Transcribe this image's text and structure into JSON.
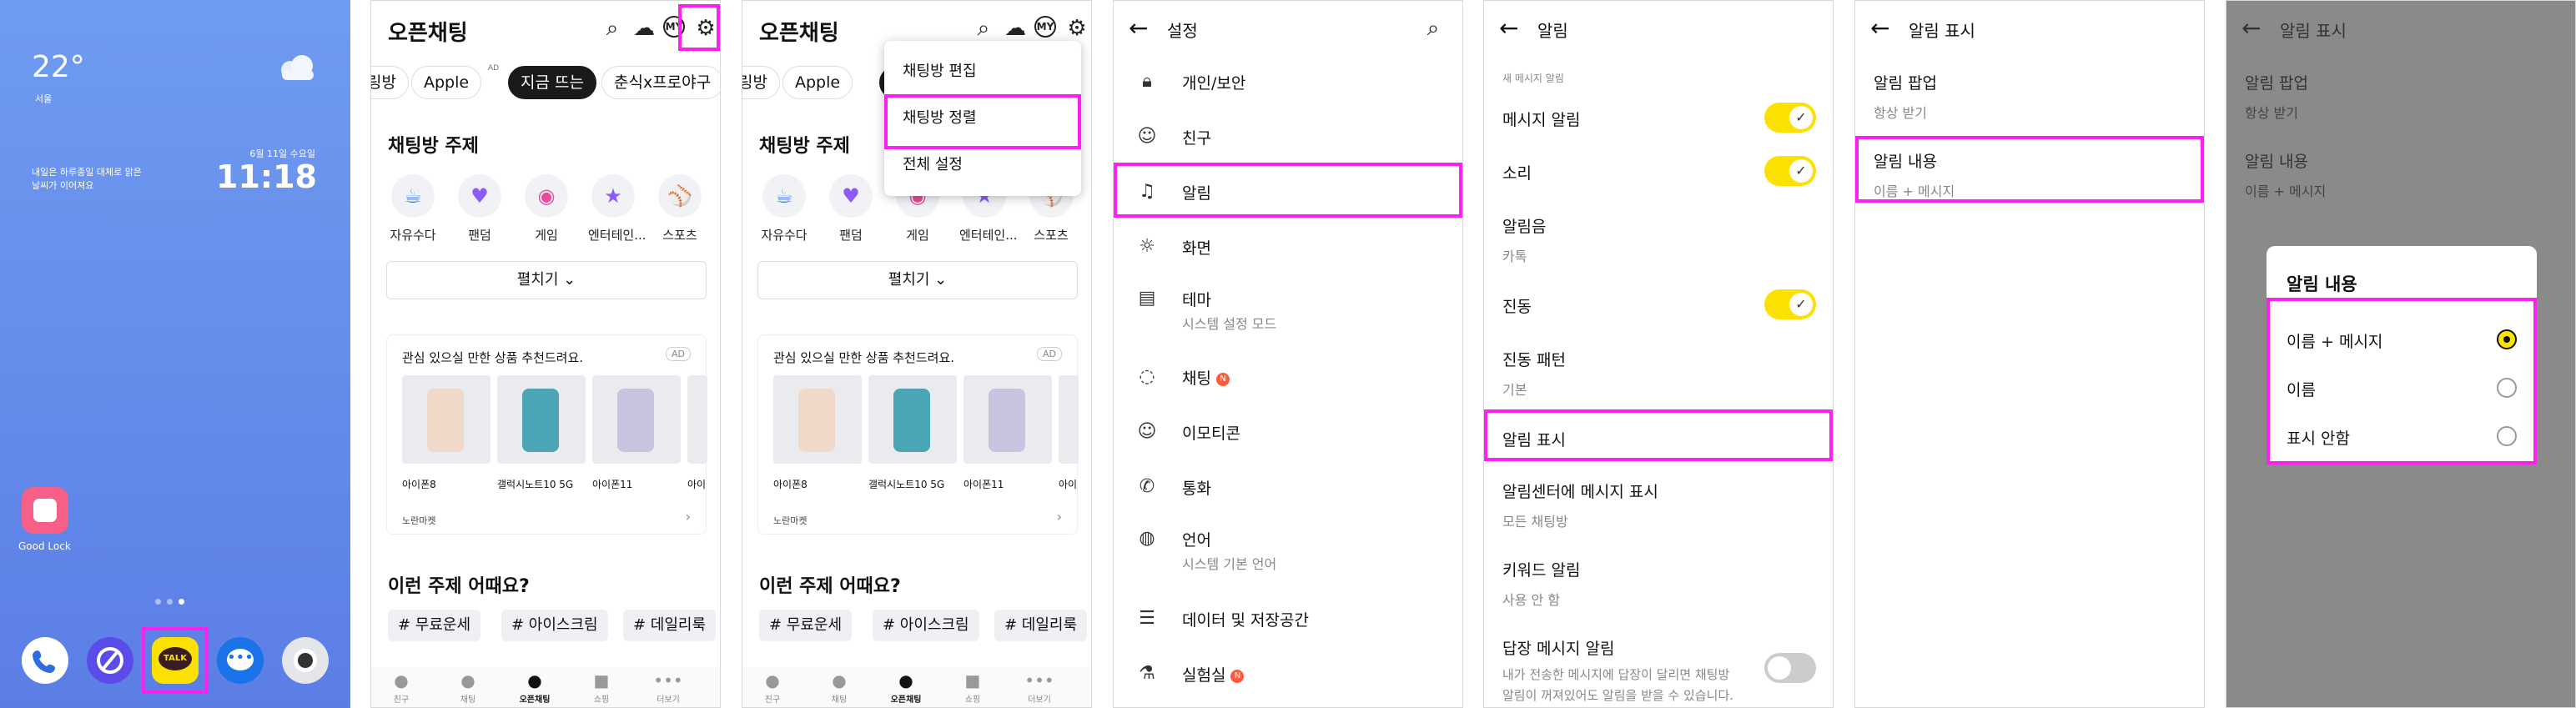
{
  "colors": {
    "highlight": "#ff1ff0",
    "kakao_yellow": "#fae100",
    "home_bg": "#6f9bf0",
    "dim_bg": "#8a8a8a"
  },
  "home": {
    "temperature": "22°",
    "location": "서울",
    "weather_msg1": "내일은 하루종일 대체로 맑은",
    "weather_msg2": "날씨가 이어져요",
    "date": "6월 11일 수요일",
    "time": "11:18",
    "app_label": "Good Lock",
    "dock_icons": [
      "phone-icon",
      "browser-icon",
      "kakaotalk-icon",
      "messages-icon",
      "camera-icon"
    ],
    "talk_text": "TALK"
  },
  "openchat": {
    "title": "오픈채팅",
    "chips": [
      "링방",
      "Apple",
      "지금 뜨는",
      "춘식x프로야구"
    ],
    "chip_ad": "AD",
    "section_topic": "채팅방 주제",
    "topics": [
      "자유수다",
      "팬덤",
      "게임",
      "엔터테인...",
      "스포츠"
    ],
    "expand": "펼치기",
    "ad_header": "관심 있으실 만한 상품 추천드려요.",
    "ad_badge": "AD",
    "products": [
      "아이폰8",
      "갤럭시노트10 5G",
      "아이폰11",
      "아이"
    ],
    "ad_footer": "노란마켓",
    "section_suggest": "이런 주제 어때요?",
    "tags": [
      "# 무료운세",
      "# 아이스크림",
      "# 데일리룩"
    ],
    "tabs": [
      "친구",
      "채팅",
      "오픈채팅",
      "쇼핑",
      "더보기"
    ],
    "my_badge": "MY"
  },
  "menu": {
    "items": [
      "채팅방 편집",
      "채팅방 정렬",
      "전체 설정"
    ]
  },
  "settings": {
    "title": "설정",
    "items": [
      {
        "label": "개인/보안",
        "sub": "",
        "icon": "lock-icon"
      },
      {
        "label": "친구",
        "sub": "",
        "icon": "person-icon"
      },
      {
        "label": "알림",
        "sub": "",
        "icon": "bell-icon"
      },
      {
        "label": "화면",
        "sub": "",
        "icon": "screen-icon"
      },
      {
        "label": "테마",
        "sub": "시스템 설정 모드",
        "icon": "theme-icon"
      },
      {
        "label": "채팅",
        "sub": "",
        "icon": "chat-icon",
        "badge": "N"
      },
      {
        "label": "이모티콘",
        "sub": "",
        "icon": "emoji-icon"
      },
      {
        "label": "통화",
        "sub": "",
        "icon": "call-icon"
      },
      {
        "label": "언어",
        "sub": "시스템 기본 언어",
        "icon": "globe-icon"
      },
      {
        "label": "데이터 및 저장공간",
        "sub": "",
        "icon": "storage-icon"
      },
      {
        "label": "실험실",
        "sub": "",
        "icon": "lab-icon",
        "badge": "N"
      }
    ]
  },
  "notifications": {
    "title": "알림",
    "section": "새 메시지 알림",
    "rows": [
      {
        "label": "메시지 알림",
        "sub": "",
        "toggle": true
      },
      {
        "label": "소리",
        "sub": "",
        "toggle": true
      },
      {
        "label": "알림음",
        "sub": "카톡",
        "toggle": null
      },
      {
        "label": "진동",
        "sub": "",
        "toggle": true
      },
      {
        "label": "진동 패턴",
        "sub": "기본",
        "toggle": null
      },
      {
        "label": "알림 표시",
        "sub": "",
        "toggle": null
      },
      {
        "label": "알림센터에 메시지 표시",
        "sub": "모든 채팅방",
        "toggle": null
      },
      {
        "label": "키워드 알림",
        "sub": "사용 안 함",
        "toggle": null
      },
      {
        "label": "답장 메시지 알림",
        "sub": "",
        "toggle": false
      }
    ],
    "reply_desc1": "내가 전송한 메시지에 답장이 달리면 채팅방",
    "reply_desc2": "알림이 꺼져있어도 알림을 받을 수 있습니다."
  },
  "display": {
    "title": "알림 표시",
    "popup_label": "알림 팝업",
    "popup_value": "항상 받기",
    "content_label": "알림 내용",
    "content_value": "이름 + 메시지"
  },
  "dialog": {
    "title": "알림 내용",
    "options": [
      "이름 + 메시지",
      "이름",
      "표시 안함"
    ],
    "selected": 0
  }
}
